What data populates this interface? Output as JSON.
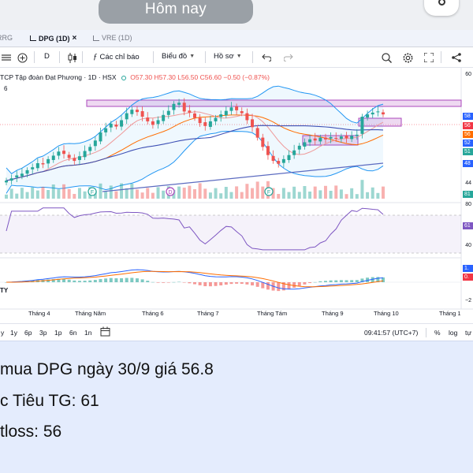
{
  "top": {
    "today_label": "Hôm nay"
  },
  "tabs": [
    {
      "label": "RRG"
    },
    {
      "label": "DPG (1D)"
    },
    {
      "label": "VRE (1D)"
    }
  ],
  "tab_close": "×",
  "toolbar": {
    "interval": "D",
    "indicators": "Các chỉ báo",
    "chart_type": "Biểu đồ",
    "profile": "Hồ sơ"
  },
  "legend": {
    "title": "TCP Tập đoàn Đạt Phương · 1D · HSX",
    "ohlc": "O57.30 H57.30 L56.50 C56.60 −0.50 (−0.87%)",
    "sub": "6"
  },
  "price_axis": [
    {
      "label": "60",
      "kind": "num"
    },
    {
      "label": "58",
      "kind": "tag",
      "color": "#2962ff"
    },
    {
      "label": "56",
      "kind": "tag",
      "color": "#f23645"
    },
    {
      "label": "56",
      "kind": "tag",
      "color": "#ff6d00"
    },
    {
      "label": "52",
      "kind": "tag",
      "color": "#2962ff"
    },
    {
      "label": "51",
      "kind": "tag",
      "color": "#26a69a"
    },
    {
      "label": "48",
      "kind": "tag",
      "color": "#2962ff"
    },
    {
      "label": "44",
      "kind": "num"
    },
    {
      "label": "81",
      "kind": "tag",
      "color": "#26a69a"
    },
    {
      "label": "80",
      "kind": "num"
    },
    {
      "label": "61",
      "kind": "tag",
      "color": "#7e57c2"
    },
    {
      "label": "40",
      "kind": "num"
    },
    {
      "label": "1.",
      "kind": "tag",
      "color": "#2962ff"
    },
    {
      "label": "0.",
      "kind": "tag",
      "color": "#f23645"
    },
    {
      "label": "−2",
      "kind": "num"
    }
  ],
  "time_axis": [
    "Tháng 4",
    "Tháng Năm",
    "Tháng 6",
    "Tháng 7",
    "Tháng Tám",
    "Tháng 9",
    "Tháng 10",
    "Tháng 1"
  ],
  "markers": [
    "F",
    "D",
    "F"
  ],
  "macd_tag": "TY",
  "chart_data": {
    "type": "candlestick",
    "close": [
      45.2,
      45.6,
      46.1,
      46.4,
      47.0,
      47.5,
      48.2,
      48.0,
      48.9,
      49.5,
      50.2,
      49.8,
      49.1,
      48.6,
      49.4,
      50.3,
      51.0,
      52.1,
      53.5,
      54.2,
      55.0,
      54.5,
      55.6,
      56.8,
      57.4,
      57.0,
      56.2,
      55.4,
      54.8,
      55.6,
      56.5,
      57.2,
      58.4,
      58.6,
      57.1,
      56.9,
      56.0,
      55.1,
      54.6,
      55.4,
      56.0,
      56.6,
      57.2,
      57.8,
      57.3,
      56.8,
      55.6,
      54.4,
      52.6,
      51.0,
      49.6,
      48.6,
      48.1,
      48.9,
      49.6,
      50.4,
      51.2,
      51.8,
      52.3,
      52.1,
      52.6,
      52.3,
      52.7,
      52.4,
      52.8,
      52.5,
      52.9,
      53.1,
      56.2,
      56.6,
      56.9,
      57.1,
      56.6
    ],
    "bollinger_upper": 59.0,
    "bollinger_lower": 45.5,
    "rsi_levels": [
      80,
      40
    ],
    "last_rsi": 61,
    "ylim": [
      44,
      60
    ]
  },
  "rangebar": {
    "ranges": [
      "y",
      "1y",
      "6p",
      "3p",
      "1p",
      "6n",
      "1n"
    ],
    "time": "09:41:57 (UTC+7)",
    "percent": "%",
    "log": "log",
    "auto": "tự"
  },
  "message": {
    "line1": "mua DPG ngày 30/9 giá 56.8",
    "line2": "c Tiêu TG: 61",
    "line3": "tloss: 56"
  }
}
